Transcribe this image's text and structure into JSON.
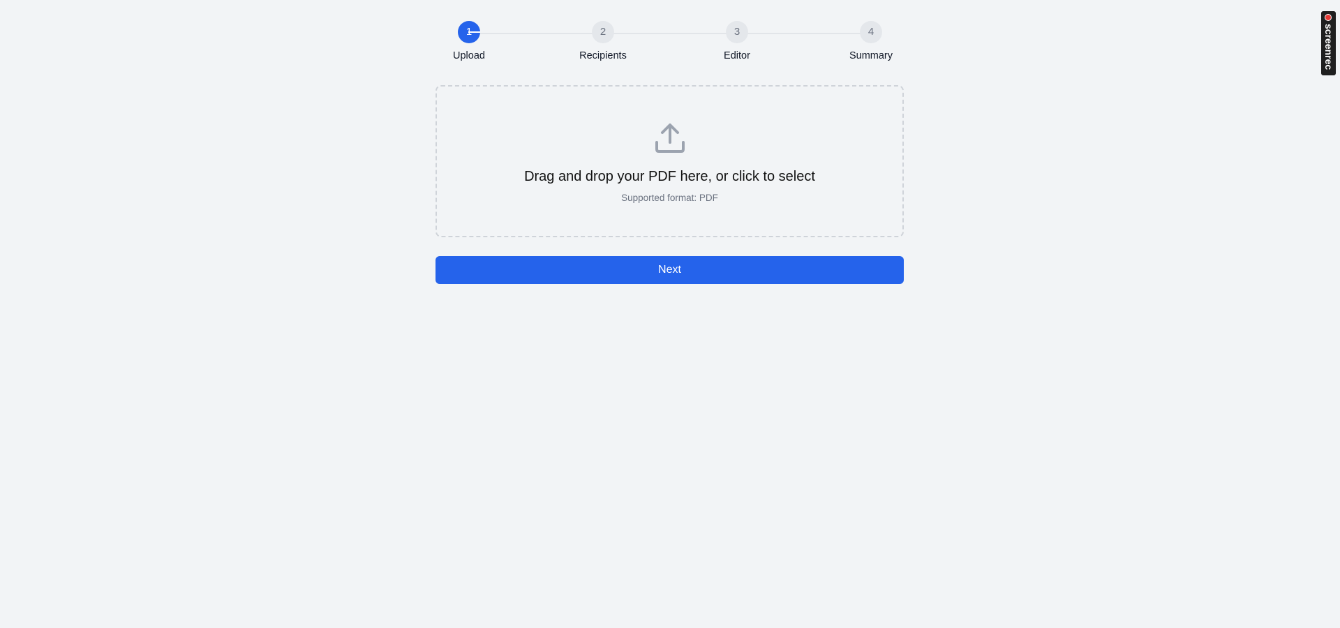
{
  "stepper": {
    "steps": [
      {
        "number": "1",
        "label": "Upload",
        "active": true
      },
      {
        "number": "2",
        "label": "Recipients",
        "active": false
      },
      {
        "number": "3",
        "label": "Editor",
        "active": false
      },
      {
        "number": "4",
        "label": "Summary",
        "active": false
      }
    ]
  },
  "dropzone": {
    "icon": "upload-icon",
    "title": "Drag and drop your PDF here, or click to select",
    "subtitle": "Supported format: PDF"
  },
  "actions": {
    "next_label": "Next"
  },
  "watermark": {
    "text": "screenrec"
  },
  "colors": {
    "accent": "#2563eb",
    "background": "#f2f4f6",
    "inactive_step": "#e4e7eb"
  }
}
